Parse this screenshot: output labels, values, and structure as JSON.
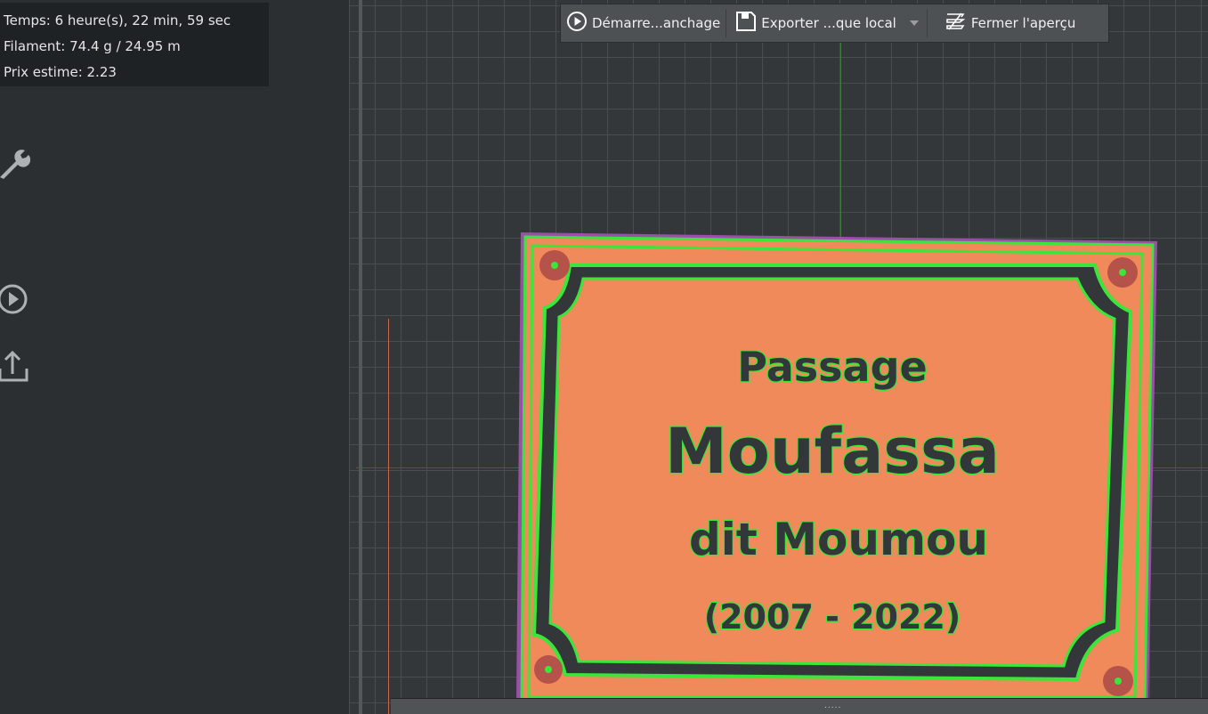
{
  "stats": {
    "time": "Temps: 6 heure(s), 22 min, 59 sec",
    "filament": "Filament: 74.4 g / 24.95 m",
    "price": "Prix estime: 2.23"
  },
  "toolbar": {
    "start_label": "Démarre...anchage",
    "export_label": "Exporter ...que local",
    "close_label": "Fermer l'aperçu"
  },
  "plaque": {
    "line1": "Passage",
    "line2": "Moufassa",
    "line3": "dit Moumou",
    "line4": "(2007 - 2022)"
  },
  "bottom": {
    "handle": "....."
  },
  "colors": {
    "fill": "#f08a5a",
    "outline": "#39e639",
    "wall": "#9a4fa8"
  }
}
